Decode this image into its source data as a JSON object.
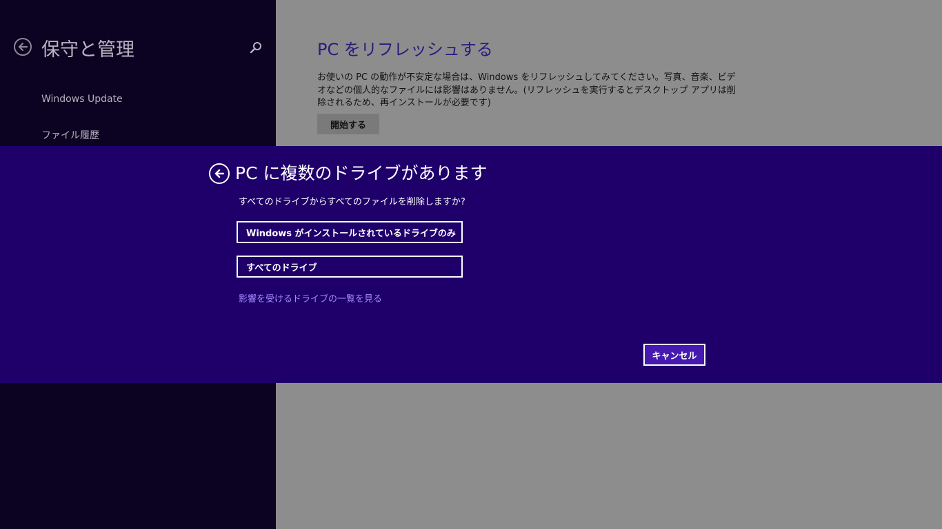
{
  "colors": {
    "left_pane_bg": "#0b0321",
    "content_bg": "#8d8d8d",
    "dialog_bg": "#1f006b",
    "accent_title": "#2c1a7f",
    "link": "#a58bff",
    "cancel_bg": "#4619b0"
  },
  "left_pane": {
    "back_icon": "back-arrow-icon",
    "title": "保守と管理",
    "search_icon": "search-icon",
    "nav_items": [
      {
        "label": "Windows Update"
      },
      {
        "label": "ファイル履歴"
      }
    ]
  },
  "content": {
    "section_title": "PC をリフレッシュする",
    "description": "お使いの PC の動作が不安定な場合は、Windows をリフレッシュしてみてください。写真、音楽、ビデオなどの個人的なファイルには影響はありません。(リフレッシュを実行するとデスクトップ アプリは削除されるため、再インストールが必要です)",
    "start_button": "開始する"
  },
  "dialog": {
    "back_icon": "back-arrow-icon",
    "title": "PC に複数のドライブがあります",
    "question": "すべてのドライブからすべてのファイルを削除しますか?",
    "option_windows_drive": "Windows がインストールされているドライブのみ",
    "option_all_drives": "すべてのドライブ",
    "drive_list_link": "影響を受けるドライブの一覧を見る",
    "cancel_button": "キャンセル"
  }
}
